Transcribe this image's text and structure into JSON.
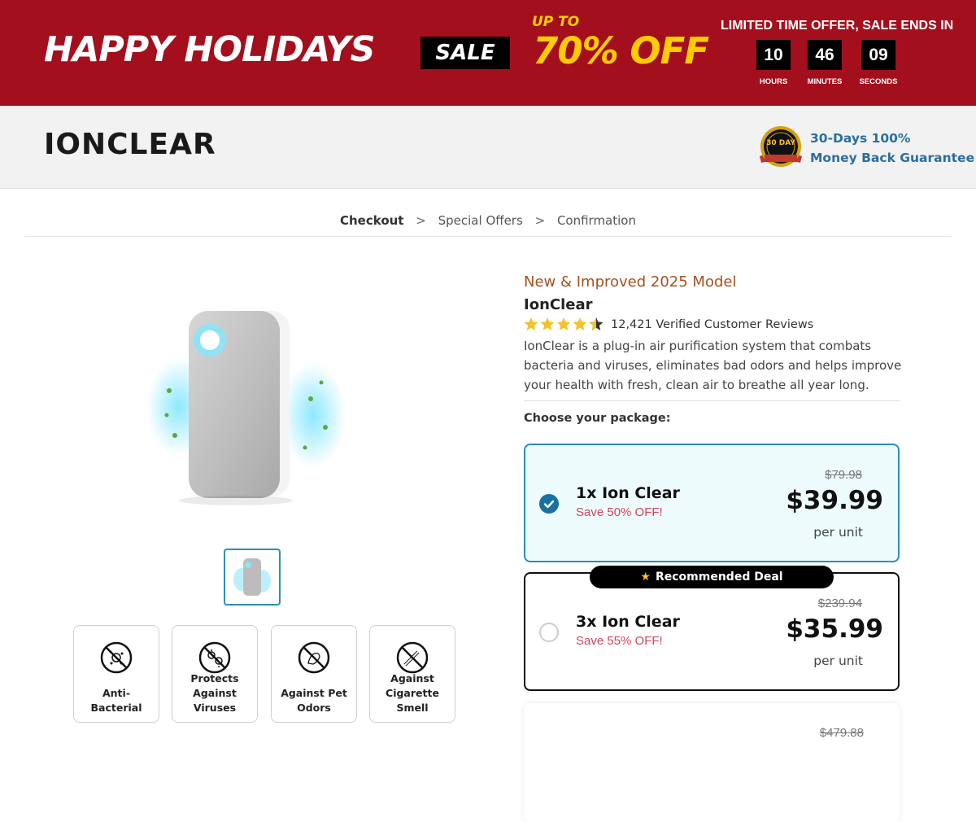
{
  "banner": {
    "title": "HAPPY HOLIDAYS",
    "sale_badge": "SALE",
    "up_to": "UP TO",
    "discount": "70% OFF",
    "limited_text": "LIMITED TIME OFFER, SALE ENDS IN",
    "countdown": {
      "hours": "10",
      "hours_label": "HOURS",
      "minutes": "46",
      "minutes_label": "MINUTES",
      "seconds": "09",
      "seconds_label": "SECONDS"
    },
    "background_color": "#a30f1d",
    "accent_color": "#ffcc00"
  },
  "header": {
    "logo": "IONCLEAR",
    "guarantee_line1": "30-Days 100%",
    "guarantee_line2": "Money Back Guarantee",
    "seal_text": "30 DAY"
  },
  "breadcrumb": {
    "step1": "Checkout",
    "step2": "Special Offers",
    "step3": "Confirmation",
    "separator": ">"
  },
  "product": {
    "model": "New & Improved 2025 Model",
    "name": "IonClear",
    "rating": 4.5,
    "reviews": "12,421 Verified Customer Reviews",
    "description": "IonClear is a plug-in air purification system that combats bacteria and viruses, eliminates bad odors and helps improve your health with fresh, clean air to breathe all year long.",
    "choose_label": "Choose your package:"
  },
  "features": [
    {
      "label": "Anti-Bacterial",
      "icon": "no-bacteria-icon"
    },
    {
      "label": "Protects Against Viruses",
      "icon": "no-virus-icon"
    },
    {
      "label": "Against Pet Odors",
      "icon": "no-pet-icon"
    },
    {
      "label": "Against Cigarette Smell",
      "icon": "no-smoking-icon"
    }
  ],
  "packages": [
    {
      "qty": "1x Ion Clear",
      "save": "Save 50% OFF!",
      "old_price": "$79.98",
      "price": "$39.99",
      "unit": "per unit",
      "selected": true
    },
    {
      "qty": "3x Ion Clear",
      "save": "Save 55% OFF!",
      "old_price": "$239.94",
      "price": "$35.99",
      "unit": "per unit",
      "selected": false
    },
    {
      "old_price": "$479.88"
    }
  ],
  "recommended_label": "Recommended Deal"
}
